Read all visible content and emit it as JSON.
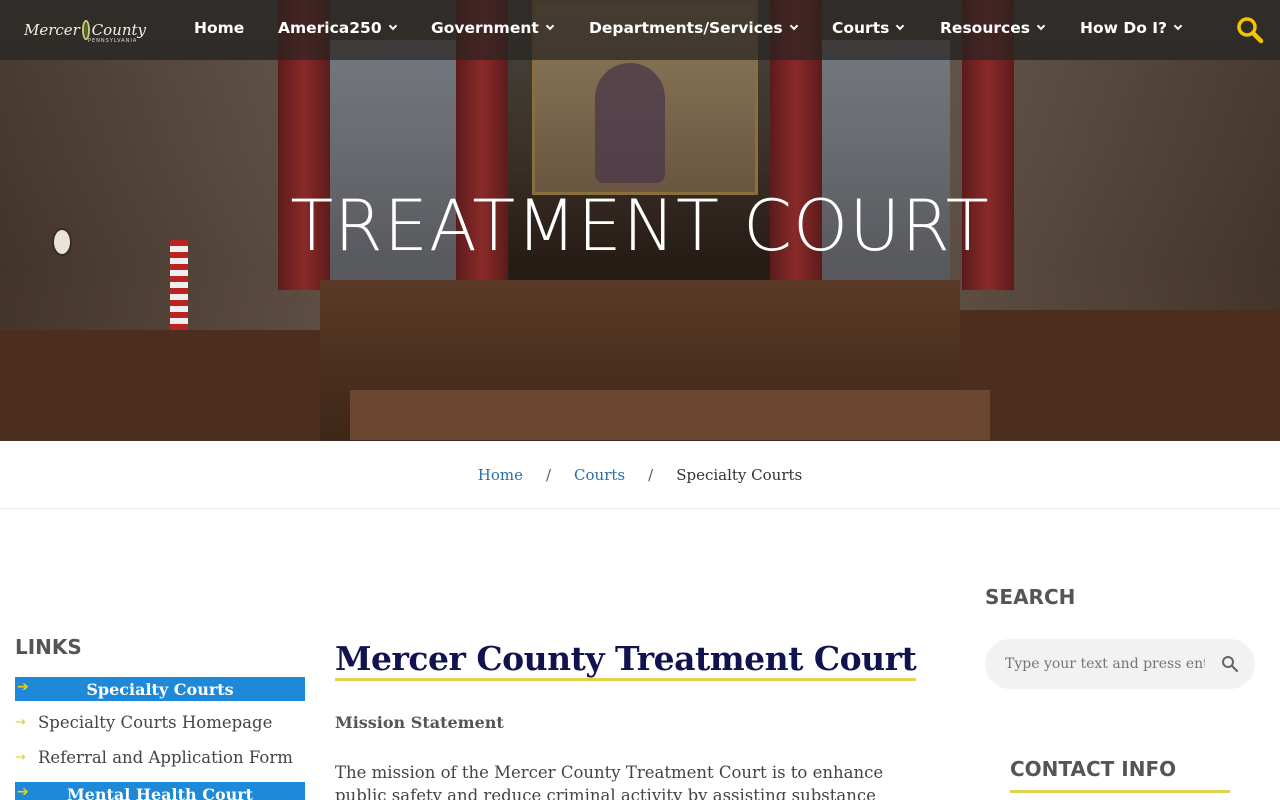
{
  "nav": {
    "logo_text": "Mercer County",
    "logo_subtext": "PENNSYLVANIA",
    "items": [
      {
        "label": "Home",
        "has_dropdown": false
      },
      {
        "label": "America250",
        "has_dropdown": true
      },
      {
        "label": "Government",
        "has_dropdown": true
      },
      {
        "label": "Departments/Services",
        "has_dropdown": true
      },
      {
        "label": "Courts",
        "has_dropdown": true
      },
      {
        "label": "Resources",
        "has_dropdown": true
      },
      {
        "label": "How Do I?",
        "has_dropdown": true
      }
    ],
    "search_icon": "search-icon",
    "accent_color": "#f5c400"
  },
  "hero": {
    "title": "TREATMENT COURT"
  },
  "breadcrumb": {
    "home": "Home",
    "courts": "Courts",
    "separator": "/",
    "current": "Specialty Courts"
  },
  "sidebar": {
    "title": "LINKS",
    "sections": [
      {
        "label": "Specialty Courts"
      },
      {
        "label": "Mental Health Court"
      }
    ],
    "links": [
      {
        "label": "Specialty Courts Homepage"
      },
      {
        "label": "Referral and Application Form"
      }
    ],
    "bar_color": "#1e88d9"
  },
  "main": {
    "title": "Mercer County Treatment Court",
    "mission_label": "Mission Statement",
    "mission_text": "The mission of the Mercer County Treatment Court is to enhance public safety and reduce criminal activity by assisting substance abusers in their struggle to"
  },
  "right_sidebar": {
    "search_title": "SEARCH",
    "search_placeholder": "Type your text and press enter",
    "contact_title": "CONTACT INFO"
  }
}
